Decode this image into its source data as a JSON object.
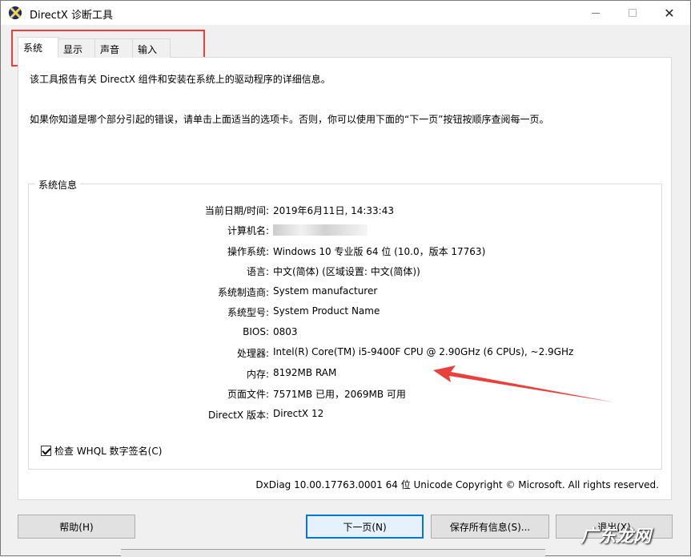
{
  "window": {
    "title": "DirectX 诊断工具"
  },
  "tabs": [
    {
      "label": "系统"
    },
    {
      "label": "显示"
    },
    {
      "label": "声音"
    },
    {
      "label": "输入"
    }
  ],
  "intro": {
    "line1": "该工具报告有关 DirectX 组件和安装在系统上的驱动程序的详细信息。",
    "line2": "如果你知道是哪个部分引起的错误，请单击上面适当的选项卡。否则，你可以使用下面的“下一页”按钮按顺序查阅每一页。"
  },
  "system_info": {
    "title": "系统信息",
    "rows": [
      {
        "label": "当前日期/时间:",
        "value": "2019年6月11日, 14:33:43"
      },
      {
        "label": "计算机名:",
        "value": ""
      },
      {
        "label": "操作系统:",
        "value": "Windows 10 专业版 64 位 (10.0，版本 17763)"
      },
      {
        "label": "语言:",
        "value": "中文(简体) (区域设置: 中文(简体))"
      },
      {
        "label": "系统制造商:",
        "value": "System manufacturer"
      },
      {
        "label": "系统型号:",
        "value": "System Product Name"
      },
      {
        "label": "BIOS:",
        "value": "0803"
      },
      {
        "label": "处理器:",
        "value": "Intel(R) Core(TM) i5-9400F CPU @ 2.90GHz (6 CPUs), ~2.9GHz"
      },
      {
        "label": "内存:",
        "value": "8192MB RAM"
      },
      {
        "label": "页面文件:",
        "value": "7571MB 已用，2069MB 可用"
      },
      {
        "label": "DirectX 版本:",
        "value": "DirectX 12"
      }
    ]
  },
  "whql": {
    "label": "检查 WHQL 数字签名(C)",
    "checked": true
  },
  "copyright": "DxDiag 10.00.17763.0001 64 位 Unicode  Copyright © Microsoft. All rights reserved.",
  "buttons": {
    "help": "帮助(H)",
    "next": "下一页(N)",
    "save": "保存所有信息(S)...",
    "exit": "退出(X)"
  },
  "watermark": "广东龙网",
  "colors": {
    "highlight": "#e8413c",
    "default_button": "#0078d7"
  }
}
